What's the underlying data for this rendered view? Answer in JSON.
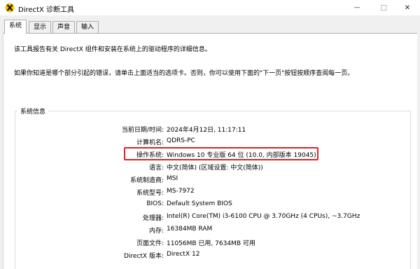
{
  "window": {
    "title": "DirectX 诊断工具",
    "minimize_glyph": "—",
    "maximize_glyph": "☐",
    "close_glyph": "✕"
  },
  "tabs": [
    {
      "label": "系统"
    },
    {
      "label": "显示"
    },
    {
      "label": "声音"
    },
    {
      "label": "输入"
    }
  ],
  "intro": {
    "line1": "该工具报告有关 DirectX 组件和安装在系统上的驱动程序的详细信息。",
    "line2": "如果你知道是哪个部分引起的错误，请单击上面适当的选项卡。否则，你可以使用下面的\"下一页\"按钮按顺序查阅每一页。"
  },
  "system_info": {
    "group_title": "系统信息",
    "rows": [
      {
        "label": "当前日期/时间:",
        "value": "2024年4月12日, 11:17:11"
      },
      {
        "label": "计算机名:",
        "value": "QDRS-PC"
      },
      {
        "label": "操作系统:",
        "value": "Windows 10 专业版 64 位 (10.0, 内部版本 19045)"
      },
      {
        "label": "语言:",
        "value": "中文(简体) (区域设置: 中文(简体))"
      },
      {
        "label": "系统制造商:",
        "value": "MSI"
      },
      {
        "label": "系统型号:",
        "value": "MS-7972"
      },
      {
        "label": "BIOS:",
        "value": "Default System BIOS"
      },
      {
        "label": "处理器:",
        "value": "Intel(R) Core(TM) i3-6100 CPU @ 3.70GHz (4 CPUs), ~3.7GHz"
      },
      {
        "label": "内存:",
        "value": "16384MB RAM"
      },
      {
        "label": "页面文件:",
        "value": "11056MB 已用, 7634MB 可用"
      },
      {
        "label": "DirectX 版本:",
        "value": "DirectX 12"
      }
    ]
  },
  "colors": {
    "highlight": "#e02020",
    "icon_yellow": "#f5c400",
    "icon_dark": "#1a1a1a"
  },
  "icons": {
    "app": "directx-x-icon"
  }
}
